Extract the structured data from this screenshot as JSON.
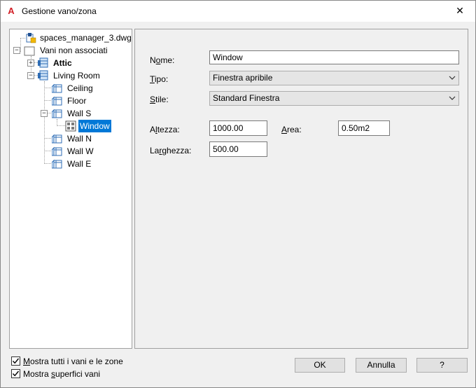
{
  "window": {
    "title": "Gestione vano/zona",
    "app_icon_letter": "A",
    "close_glyph": "✕"
  },
  "tree": {
    "root": "spaces_manager_3.dwg",
    "group": "Vani non associati",
    "attic": "Attic",
    "living_room": "Living Room",
    "ceiling": "Ceiling",
    "floor": "Floor",
    "wall_s": "Wall S",
    "window": "Window",
    "wall_n": "Wall N",
    "wall_w": "Wall W",
    "wall_e": "Wall E",
    "expand_glyph": "+",
    "collapse_glyph": "−"
  },
  "props": {
    "nome_prefix": "N",
    "nome_underlined": "o",
    "nome_suffix": "me:",
    "nome_value": "Window",
    "tipo_prefix": "",
    "tipo_underlined": "T",
    "tipo_suffix": "ipo:",
    "tipo_value": "Finestra apribile",
    "stile_prefix": "",
    "stile_underlined": "S",
    "stile_suffix": "tile:",
    "stile_value": "Standard Finestra",
    "altezza_prefix": "A",
    "altezza_underlined": "l",
    "altezza_suffix": "tezza:",
    "altezza_value": "1000.00",
    "area_prefix": "",
    "area_underlined": "A",
    "area_suffix": "rea:",
    "area_value": "0.50m2",
    "larghezza_prefix": "La",
    "larghezza_underlined": "r",
    "larghezza_suffix": "ghezza:",
    "larghezza_value": "500.00"
  },
  "bottom": {
    "show_all_prefix": "",
    "show_all_underlined": "M",
    "show_all_suffix": "ostra tutti i vani e le zone",
    "show_all_checked": true,
    "show_surfaces_prefix": "Mostra ",
    "show_surfaces_underlined": "s",
    "show_surfaces_suffix": "uperfici vani",
    "show_surfaces_checked": true,
    "ok": "OK",
    "cancel": "Annulla",
    "help": "?"
  },
  "colors": {
    "accent": "#0078d7",
    "app_icon": "#d21f26"
  }
}
